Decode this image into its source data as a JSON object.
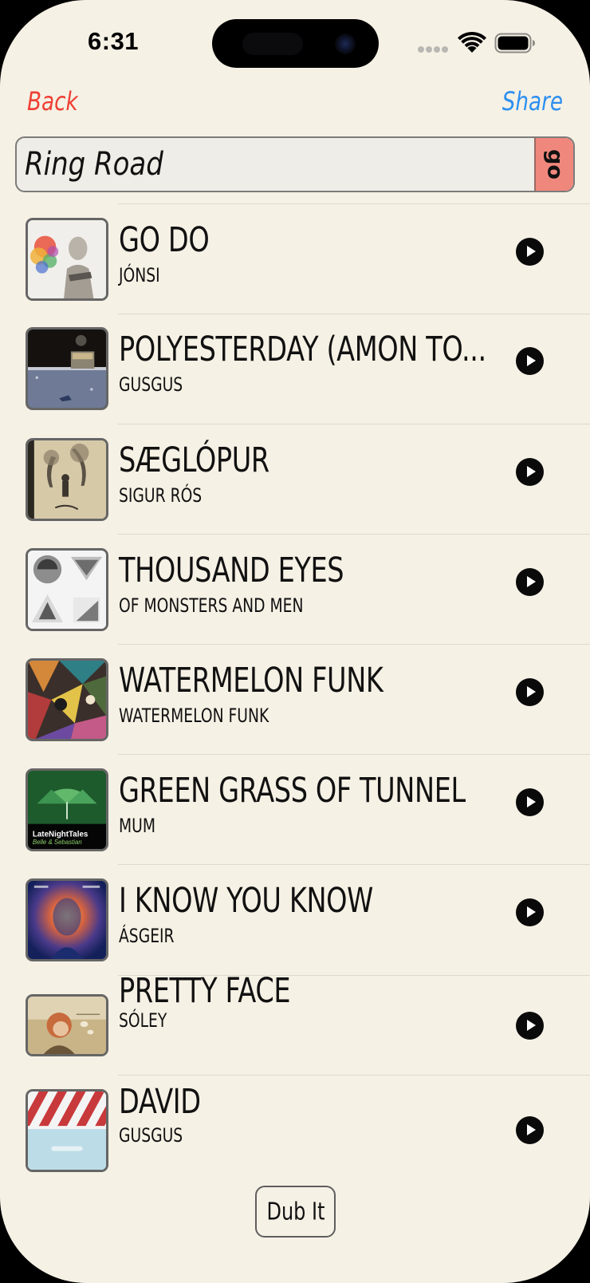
{
  "status_bar": {
    "time": "6:31"
  },
  "nav": {
    "back_label": "Back",
    "share_label": "Share",
    "back_color": "#ef3f34",
    "share_color": "#2d8ff0"
  },
  "title_field": {
    "value": "Ring Road",
    "go_label": "go"
  },
  "tracks": [
    {
      "title": "GO DO",
      "artist": "JÓNSI",
      "art": "jonsi-go-cover"
    },
    {
      "title": "POLYESTERDAY (AMON TO...",
      "artist": "GUSGUS",
      "art": "gusgus-polyesterday-cover"
    },
    {
      "title": "SÆGLÓPUR",
      "artist": "SIGUR RÓS",
      "art": "sigur-ros-takk-cover"
    },
    {
      "title": "THOUSAND EYES",
      "artist": "OF MONSTERS AND MEN",
      "art": "of-monsters-and-men-cover"
    },
    {
      "title": "WATERMELON FUNK",
      "artist": "WATERMELON FUNK",
      "art": "watermelon-funk-cover"
    },
    {
      "title": "GREEN GRASS OF TUNNEL",
      "artist": "MUM",
      "art": "late-night-tales-cover",
      "art_text": [
        "LateNightTales",
        "Belle & Sebastian"
      ]
    },
    {
      "title": "I KNOW YOU KNOW",
      "artist": "ÁSGEIR",
      "art": "asgeir-afterglow-cover"
    },
    {
      "title": "PRETTY FACE",
      "artist": "SÓLEY",
      "art": "soley-cover"
    },
    {
      "title": "DAVID",
      "artist": "GUSGUS",
      "art": "gusgus-cover"
    }
  ],
  "dub_button_label": "Dub It",
  "colors": {
    "background": "#f6f1e5",
    "play_button": "#0a0a0a",
    "go_button": "#f0877d"
  }
}
